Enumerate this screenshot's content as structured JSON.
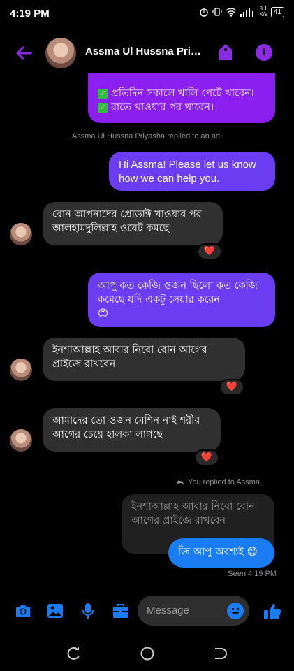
{
  "status_bar": {
    "time": "4:19 PM",
    "speed_value": "8.1",
    "speed_unit": "K/s",
    "battery": "41"
  },
  "header": {
    "contact_name": "Assma Ul Hussna Priy...",
    "back_icon": "back-arrow-icon",
    "tag_icon": "tag-icon",
    "info_icon": "info-icon",
    "info_glyph": "i",
    "accent_color": "#8a2be2"
  },
  "messages": {
    "ad_lines": [
      "প্রতিদিন সকালে খালি পেটে খাবেন।",
      "রাতে খাওয়ার পর খাবেন।"
    ],
    "system_reply": "Assma Ul Hussna Priyasha replied to an ad.",
    "greeting": "Hi Assma! Please let us know how we can help you.",
    "in1": "বোন আপনাদের প্রোডাক্ট খাওয়ার পর আলহামদুলিল্লাহ ওয়েট কমছে",
    "out2": "আপু কত কেজি ওজন ছিলো কত কেজি কমেছে যদি একটু সেয়ার করেন",
    "out2_emoji": "😊",
    "in2": "ইনশাআল্লাহ আবার নিবো  বোন আগের প্রাইজে রাখবেন",
    "in3": "আমাদের তো ওজন মেশিন নাই শরীর আগের চেয়ে হালকা লাগছে",
    "reaction": "❤️",
    "replied_label": "You replied to Assma",
    "quoted": "ইনশাআল্লাহ আবার নিবো  বোন আগের প্রাইজে রাখবেন",
    "reply": "জি আপু অবশ্যই 😊",
    "seen": "Seen 4:19 PM"
  },
  "composer": {
    "placeholder": "Message",
    "icons": [
      "camera-icon",
      "image-icon",
      "microphone-icon",
      "briefcase-icon",
      "emoji-icon",
      "thumbs-up-icon"
    ],
    "accent_color": "#1a7cf2"
  },
  "navbar": {
    "icons": [
      "recent-apps-icon",
      "home-icon",
      "back-icon"
    ]
  }
}
